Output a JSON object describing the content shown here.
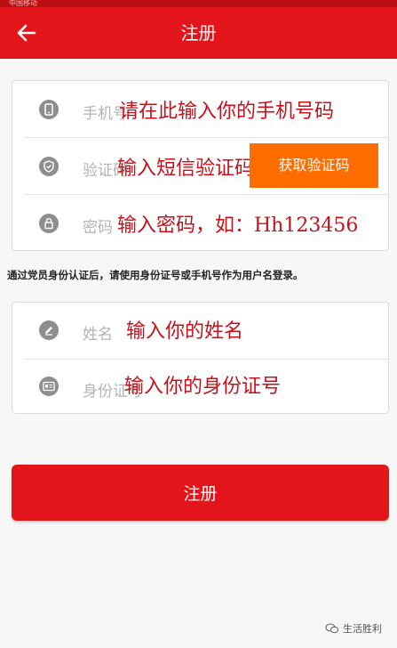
{
  "status_bar": {
    "text": "中国移动"
  },
  "app_bar": {
    "title": "注册",
    "back_icon": "arrow-left-icon"
  },
  "form": {
    "phone": {
      "icon": "phone-icon",
      "label": "手机号",
      "placeholder": "请在此输入你的手机号码"
    },
    "code": {
      "icon": "shield-icon",
      "label": "验证码",
      "placeholder": "输入短信验证码",
      "button_label": "获取验证码"
    },
    "password": {
      "icon": "lock-icon",
      "label": "密码",
      "placeholder": "输入密码，如：Hh123456"
    }
  },
  "notice": "通过党员身份认证后，请使用身份证号或手机号作为用户名登录。",
  "identity": {
    "name": {
      "icon": "pen-icon",
      "label": "姓名",
      "placeholder": "输入你的姓名"
    },
    "id_number": {
      "icon": "id-card-icon",
      "label": "身份证号",
      "placeholder": "输入你的身份证号"
    }
  },
  "submit_label": "注册",
  "watermark": {
    "text": "生活胜利",
    "icon": "chat-bubble-icon"
  },
  "colors": {
    "primary": "#e3141a",
    "accent": "#ff6d00",
    "hint_text": "#c8101a"
  }
}
